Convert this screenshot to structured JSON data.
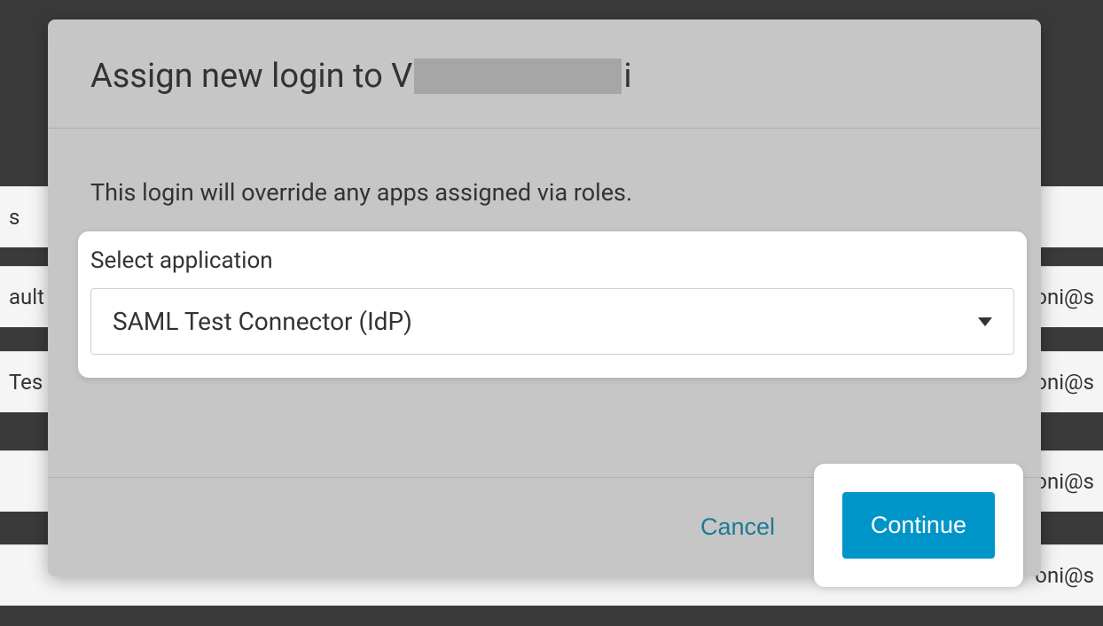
{
  "background": {
    "rows": [
      {
        "left": "s",
        "right": ""
      },
      {
        "left": "ault",
        "right": "oni@s"
      },
      {
        "left": " Tes",
        "right": "oni@s"
      },
      {
        "left": "",
        "right": "oni@s"
      },
      {
        "left": "",
        "right": "oni@s"
      }
    ]
  },
  "modal": {
    "title_prefix": "Assign new login to V",
    "title_suffix": "i",
    "description": "This login will override any apps assigned via roles.",
    "select": {
      "label": "Select application",
      "value": "SAML Test Connector (IdP)"
    },
    "actions": {
      "cancel_label": "Cancel",
      "continue_label": "Continue"
    }
  }
}
